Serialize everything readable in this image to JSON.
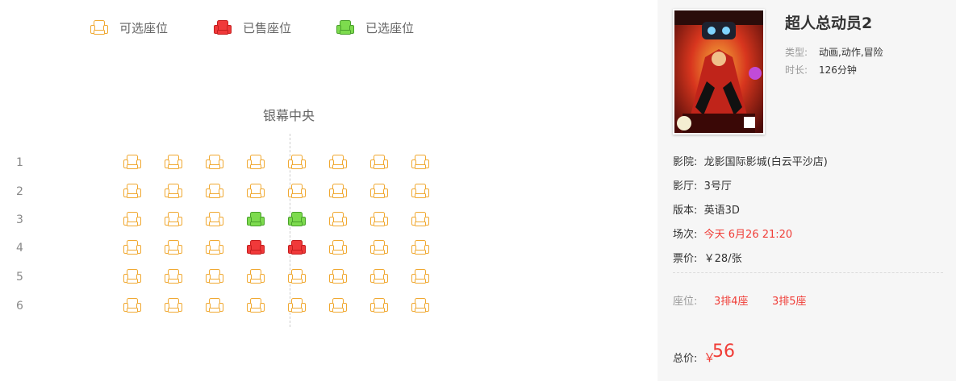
{
  "legend": [
    {
      "label": "可选座位",
      "status": "available"
    },
    {
      "label": "已售座位",
      "status": "sold"
    },
    {
      "label": "已选座位",
      "status": "selected"
    }
  ],
  "screen_label": "银幕中央",
  "rows": [
    "1",
    "2",
    "3",
    "4",
    "5",
    "6"
  ],
  "columns_per_row": 8,
  "sold_seats": [
    [
      4,
      4
    ],
    [
      4,
      5
    ]
  ],
  "selected_seats": [
    [
      3,
      4
    ],
    [
      3,
      5
    ]
  ],
  "colors": {
    "available": "#f0a830",
    "sold": "#f0393a",
    "selected": "#7ddb4e",
    "accent_red": "#f03d37"
  },
  "movie": {
    "title": "超人总动员2",
    "type_label": "类型:",
    "type_value": "动画,动作,冒险",
    "duration_label": "时长:",
    "duration_value": "126分钟",
    "poster_title": "超人总动员2"
  },
  "info": [
    {
      "label": "影院:",
      "value": "龙影国际影城(白云平沙店)",
      "highlight": false
    },
    {
      "label": "影厅:",
      "value": "3号厅",
      "highlight": false
    },
    {
      "label": "版本:",
      "value": "英语3D",
      "highlight": false
    },
    {
      "label": "场次:",
      "value": "今天 6月26 21:20",
      "highlight": true
    },
    {
      "label": "票价:",
      "value": "￥28/张",
      "highlight": false
    }
  ],
  "seat_label": "座位:",
  "chosen_seats": [
    "3排4座",
    "3排5座"
  ],
  "total_label": "总价:",
  "total_symbol": "￥",
  "total_value": "56"
}
